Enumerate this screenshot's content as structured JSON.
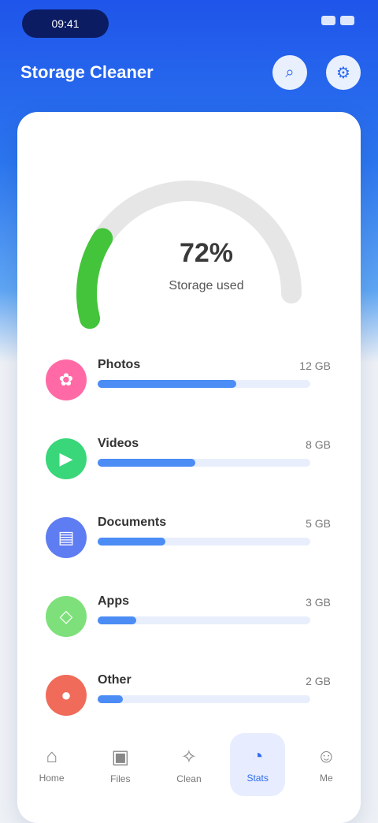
{
  "status": {
    "time": "09:41"
  },
  "header": {
    "title": "Storage Cleaner"
  },
  "gauge": {
    "fraction": 0.72,
    "value": "72%",
    "label": "Storage used"
  },
  "list": [
    {
      "name": "Photos",
      "size": "12 GB",
      "color": "#ff6aa6",
      "icon_char": "✿",
      "fraction": 0.65
    },
    {
      "name": "Videos",
      "size": "8 GB",
      "color": "#39d67a",
      "icon_char": "▶",
      "fraction": 0.46
    },
    {
      "name": "Documents",
      "size": "5 GB",
      "color": "#5f7df2",
      "icon_char": "▤",
      "fraction": 0.32
    },
    {
      "name": "Apps",
      "size": "3 GB",
      "color": "#7ee07a",
      "icon_char": "◇",
      "fraction": 0.18
    },
    {
      "name": "Other",
      "size": "2 GB",
      "color": "#f06b5a",
      "icon_char": "●",
      "fraction": 0.12
    }
  ],
  "nav": [
    {
      "label": "Home",
      "icon": "home-icon",
      "icon_char": "⌂"
    },
    {
      "label": "Files",
      "icon": "folder-icon",
      "icon_char": "▣"
    },
    {
      "label": "Clean",
      "icon": "broom-icon",
      "icon_char": "✧"
    },
    {
      "label": "Stats",
      "icon": "chart-icon",
      "icon_char": "◔"
    },
    {
      "label": "Me",
      "icon": "user-icon",
      "icon_char": "☺"
    }
  ],
  "icons": {
    "search": "search-icon",
    "settings": "gear-icon"
  }
}
